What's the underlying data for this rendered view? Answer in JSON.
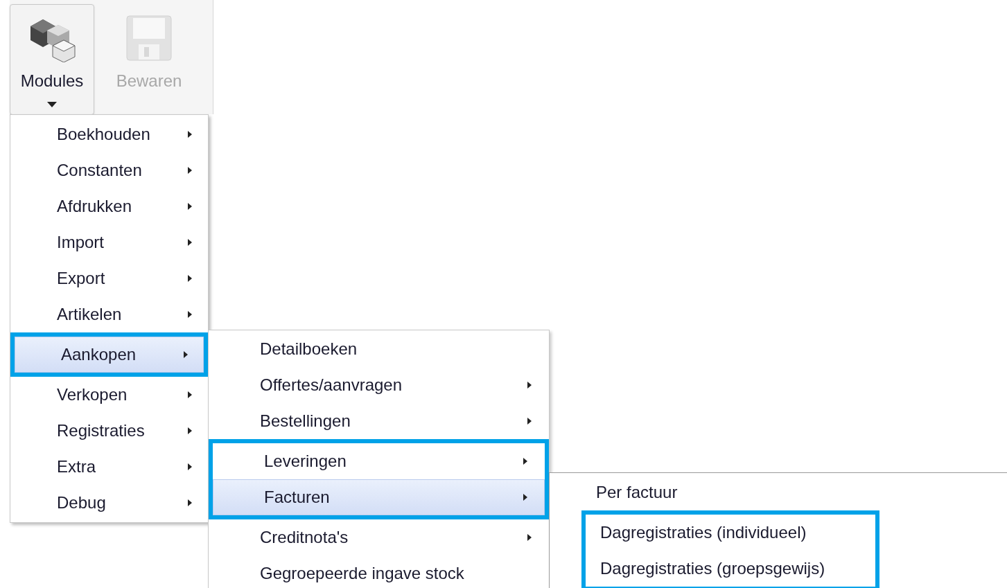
{
  "toolbar": {
    "buttons": [
      {
        "label": "Modules",
        "kind": "modules",
        "disabled": false,
        "pressed": true
      },
      {
        "label": "Bewaren",
        "kind": "save",
        "disabled": true,
        "pressed": false
      }
    ]
  },
  "menus": [
    {
      "items": [
        {
          "label": "Boekhouden",
          "submenu": true,
          "selected": false,
          "highlighted": false
        },
        {
          "label": "Constanten",
          "submenu": true,
          "selected": false,
          "highlighted": false
        },
        {
          "label": "Afdrukken",
          "submenu": true,
          "selected": false,
          "highlighted": false
        },
        {
          "label": "Import",
          "submenu": true,
          "selected": false,
          "highlighted": false
        },
        {
          "label": "Export",
          "submenu": true,
          "selected": false,
          "highlighted": false
        },
        {
          "label": "Artikelen",
          "submenu": true,
          "selected": false,
          "highlighted": false
        },
        {
          "label": "Aankopen",
          "submenu": true,
          "selected": true,
          "highlighted": true
        },
        {
          "label": "Verkopen",
          "submenu": true,
          "selected": false,
          "highlighted": false
        },
        {
          "label": "Registraties",
          "submenu": true,
          "selected": false,
          "highlighted": false
        },
        {
          "label": "Extra",
          "submenu": true,
          "selected": false,
          "highlighted": false
        },
        {
          "label": "Debug",
          "submenu": true,
          "selected": false,
          "highlighted": false
        }
      ]
    },
    {
      "items": [
        {
          "label": "Detailboeken",
          "submenu": false,
          "selected": false,
          "highlighted": false
        },
        {
          "label": "Offertes/aanvragen",
          "submenu": true,
          "selected": false,
          "highlighted": false
        },
        {
          "label": "Bestellingen",
          "submenu": true,
          "selected": false,
          "highlighted": false
        },
        {
          "label": "Leveringen",
          "submenu": true,
          "selected": false,
          "highlighted": true
        },
        {
          "label": "Facturen",
          "submenu": true,
          "selected": true,
          "highlighted": true
        },
        {
          "label": "Creditnota's",
          "submenu": true,
          "selected": false,
          "highlighted": false
        },
        {
          "label": "Gegroepeerde ingave stock",
          "submenu": false,
          "selected": false,
          "highlighted": false
        }
      ]
    },
    {
      "items": [
        {
          "label": "Per factuur",
          "submenu": false,
          "selected": false,
          "highlighted": false
        },
        {
          "label": "Dagregistraties (individueel)",
          "submenu": false,
          "selected": false,
          "highlighted": true
        },
        {
          "label": "Dagregistraties (groepsgewijs)",
          "submenu": false,
          "selected": false,
          "highlighted": true
        }
      ]
    }
  ]
}
